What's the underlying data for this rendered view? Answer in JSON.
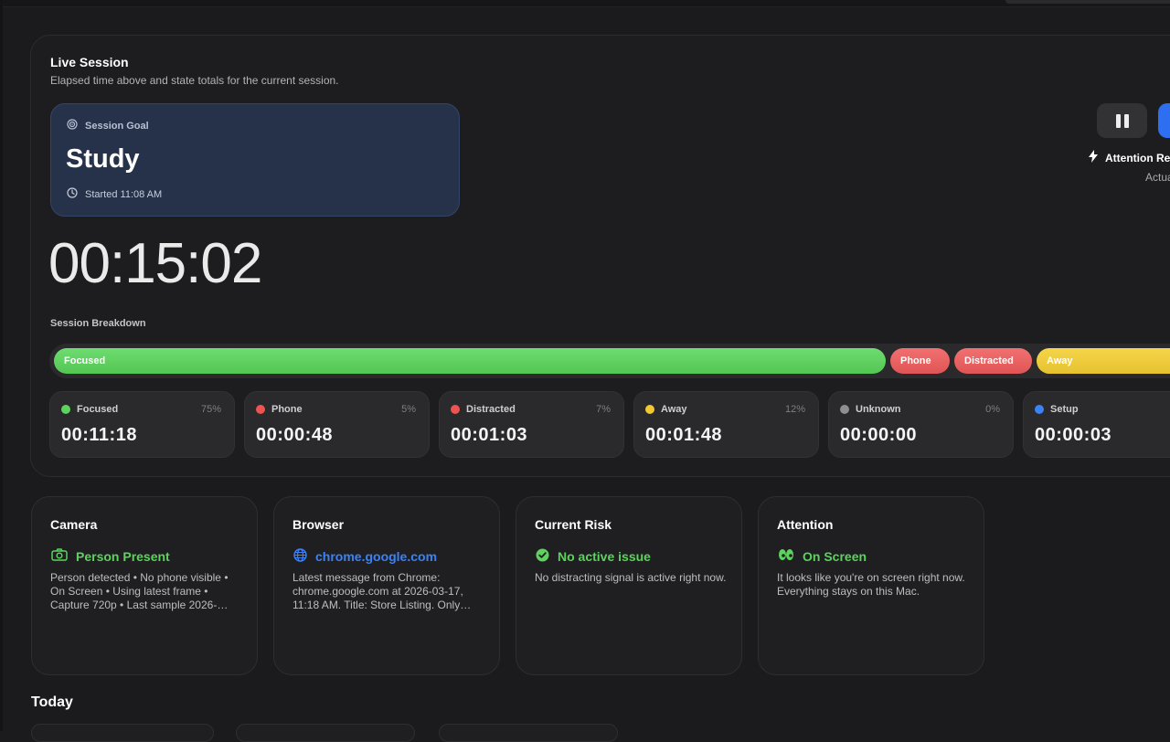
{
  "live": {
    "title": "Live Session",
    "subtitle": "Elapsed time above and state totals for the current session."
  },
  "goal": {
    "label": "Session Goal",
    "title": "Study",
    "started": "Started 11:08 AM"
  },
  "timer": "00:15:02",
  "breakdown": {
    "label": "Session Breakdown",
    "segments": [
      {
        "label": "Focused",
        "share": 0.75
      },
      {
        "label": "Phone",
        "share": 0.05
      },
      {
        "label": "Distracted",
        "share": 0.07
      },
      {
        "label": "Away",
        "share": 0.12
      }
    ]
  },
  "stats": [
    {
      "name": "Focused",
      "pct": "75%",
      "value": "00:11:18",
      "color": "#5bd35c"
    },
    {
      "name": "Phone",
      "pct": "5%",
      "value": "00:00:48",
      "color": "#ef5350"
    },
    {
      "name": "Distracted",
      "pct": "7%",
      "value": "00:01:03",
      "color": "#ef5350"
    },
    {
      "name": "Away",
      "pct": "12%",
      "value": "00:01:48",
      "color": "#f2c830"
    },
    {
      "name": "Unknown",
      "pct": "0%",
      "value": "00:00:00",
      "color": "#8e8e93"
    },
    {
      "name": "Setup",
      "pct": "",
      "value": "00:00:03",
      "color": "#3b82f6"
    }
  ],
  "controls": {
    "attention_label": "Attention Re",
    "actual_label": "Actua"
  },
  "cards": {
    "camera": {
      "title": "Camera",
      "status": "Person Present",
      "text": "Person detected • No phone visible • On Screen • Using latest frame • Capture 720p • Last sample 2026-…"
    },
    "browser": {
      "title": "Browser",
      "status": "chrome.google.com",
      "text": "Latest message from Chrome: chrome.google.com at 2026-03-17, 11:18 AM. Title: Store Listing. Only…"
    },
    "risk": {
      "title": "Current Risk",
      "status": "No active issue",
      "text": "No distracting signal is active right now."
    },
    "attention": {
      "title": "Attention",
      "status": "On Screen",
      "text": "It looks like you're on screen right now. Everything stays on this Mac."
    }
  },
  "today": {
    "title": "Today"
  },
  "colors": {
    "accent_blue": "#2e6ff2",
    "focused_green": "#5bd35c",
    "phone_red": "#ef5350",
    "away_yellow": "#f2c830"
  }
}
